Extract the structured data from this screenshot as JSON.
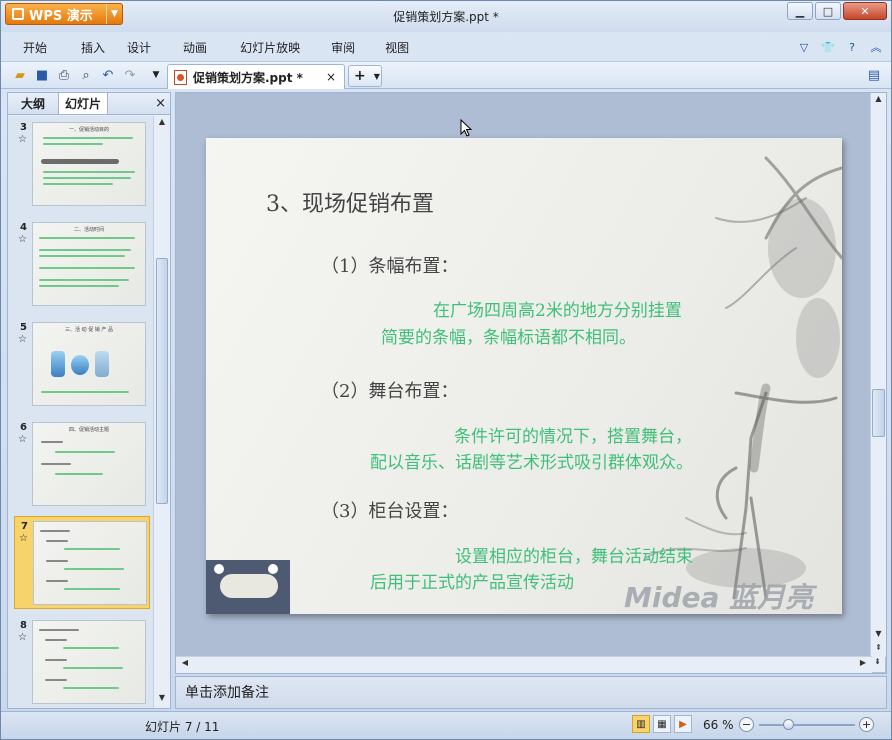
{
  "app": {
    "name": "WPS 演示",
    "window_title": "促销策划方案.ppt *"
  },
  "caption_buttons": {
    "minimize": "▁",
    "maximize": "□",
    "close": "✕"
  },
  "menu": [
    "开始",
    "插入",
    "设计",
    "动画",
    "幻灯片放映",
    "审阅",
    "视图"
  ],
  "menu_right_icons": [
    "chevron-down-icon",
    "shirt-icon",
    "help-icon",
    "expand-icon"
  ],
  "toolbar": {
    "icons": [
      "open-icon",
      "save-icon",
      "print-icon",
      "print-preview-icon",
      "undo-icon",
      "redo-icon",
      "dropdown-icon"
    ],
    "doc_tab": "促销策划方案.ppt *",
    "doc_tab_close": "×",
    "new_tab": "+"
  },
  "sidebar": {
    "tabs": [
      "大纲",
      "幻灯片"
    ],
    "active_tab": "幻灯片",
    "close": "×",
    "thumbnails": [
      {
        "num": "3",
        "title": "一、促销活动目的",
        "selected": false
      },
      {
        "num": "4",
        "title": "二、活动时间",
        "selected": false
      },
      {
        "num": "5",
        "title": "三、活 动 促 销 产 品",
        "selected": false
      },
      {
        "num": "6",
        "title": "四、促销活动主题",
        "selected": false
      },
      {
        "num": "7",
        "title": "",
        "selected": true
      },
      {
        "num": "8",
        "title": "",
        "selected": false
      }
    ]
  },
  "slide": {
    "title": "3、现场促销布置",
    "sections": [
      {
        "heading": "（1）条幅布置：",
        "lines": [
          "在广场四周高2米的地方分别挂置",
          "简要的条幅，条幅标语都不相同。"
        ]
      },
      {
        "heading": "（2）舞台布置：",
        "lines": [
          "条件许可的情况下，搭置舞台，",
          "配以音乐、话剧等艺术形式吸引群体观众。"
        ]
      },
      {
        "heading": "（3）柜台设置：",
        "lines": [
          "设置相应的柜台，舞台活动结束",
          "后用于正式的产品宣传活动"
        ]
      }
    ],
    "logo": "Midea 蓝月亮"
  },
  "notes": {
    "placeholder": "单击添加备注"
  },
  "status": {
    "slide_count": "幻灯片 7 / 11",
    "zoom": "66 %"
  },
  "colors": {
    "accent_orange": "#e5780f",
    "slide_green": "#3fbf79",
    "selected_thumb": "#f7d36b"
  }
}
